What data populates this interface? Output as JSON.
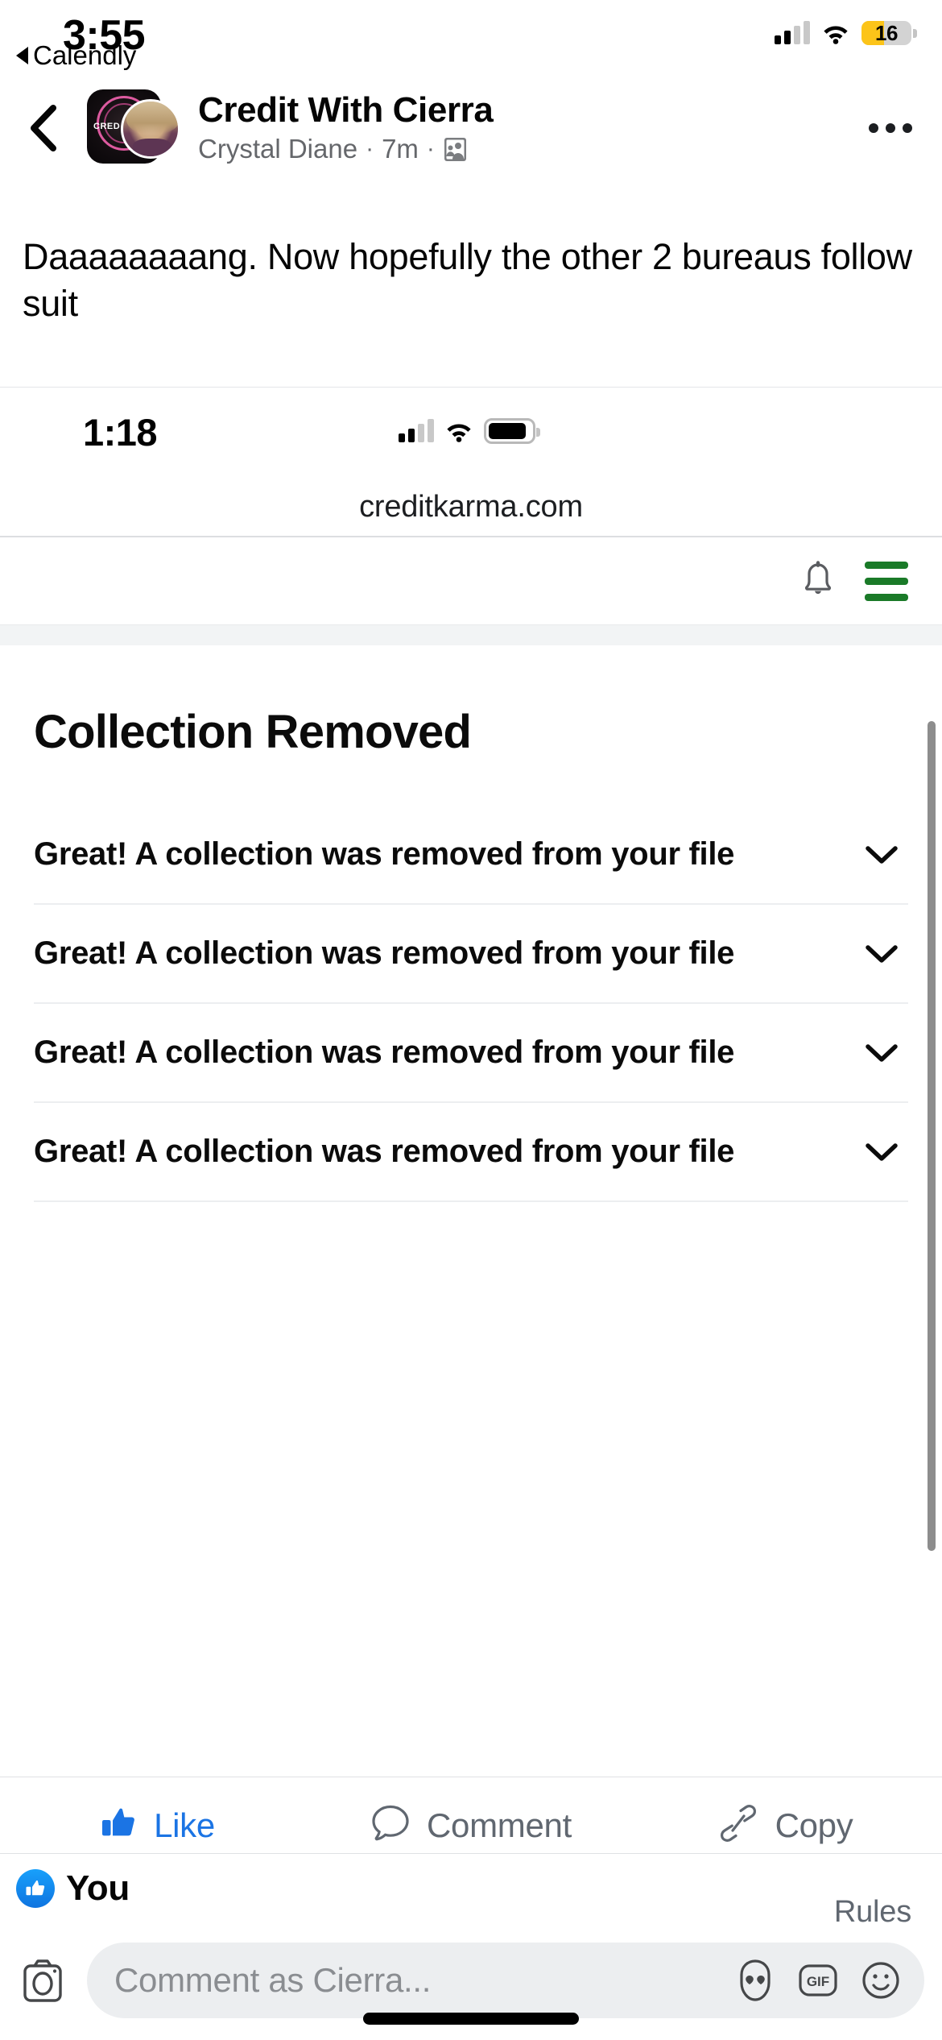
{
  "status_bar": {
    "time": "3:55",
    "back_app_label": "Calendly",
    "battery_percent": "16",
    "battery_color": "#fcc419",
    "icons": [
      "back-triangle-icon",
      "cellular-signal-icon",
      "wifi-icon",
      "battery-icon"
    ]
  },
  "post_header": {
    "back_icon": "chevron-left-icon",
    "group_name": "Credit With Cierra",
    "author": "Crystal Diane",
    "timestamp": "7m",
    "separator": "·",
    "privacy_icon": "group-privacy-icon",
    "more_icon": "more-options-icon",
    "avatar_group_text": "CRED"
  },
  "post": {
    "text": "Daaaaaaaang. Now hopefully the other 2 bureaus follow suit"
  },
  "embedded_screenshot": {
    "status_bar": {
      "time": "1:18",
      "icons": [
        "cellular-signal-icon",
        "wifi-icon",
        "battery-icon"
      ]
    },
    "browser": {
      "url": "creditkarma.com"
    },
    "nav": {
      "bell_icon": "notification-bell-icon",
      "menu_icon": "hamburger-menu-icon",
      "menu_color": "#1a7a28"
    },
    "content": {
      "heading": "Collection Removed",
      "rows": [
        {
          "text": "Great! A collection was removed from your file",
          "chevron": "chevron-down-icon"
        },
        {
          "text": "Great! A collection was removed from your file",
          "chevron": "chevron-down-icon"
        },
        {
          "text": "Great! A collection was removed from your file",
          "chevron": "chevron-down-icon"
        },
        {
          "text": "Great! A collection was removed from your file",
          "chevron": "chevron-down-icon"
        }
      ]
    },
    "scrollbar_visible": true
  },
  "actions": {
    "like": {
      "label": "Like",
      "icon": "thumbs-up-icon",
      "active": true,
      "color": "#1b74e4"
    },
    "comment": {
      "label": "Comment",
      "icon": "comment-bubble-icon",
      "active": false,
      "color": "#606770"
    },
    "copy": {
      "label": "Copy",
      "icon": "link-chain-icon",
      "active": false,
      "color": "#606770"
    }
  },
  "reactions": {
    "badge_icon": "thumbs-up-reaction-icon",
    "label": "You"
  },
  "rules": {
    "label": "Rules"
  },
  "composer": {
    "camera_icon": "camera-icon",
    "placeholder": "Comment as Cierra...",
    "avatar_sticker_icon": "avatar-sticker-icon",
    "gif_icon": "gif-icon",
    "gif_label": "GIF",
    "emoji_icon": "emoji-smiley-icon"
  }
}
